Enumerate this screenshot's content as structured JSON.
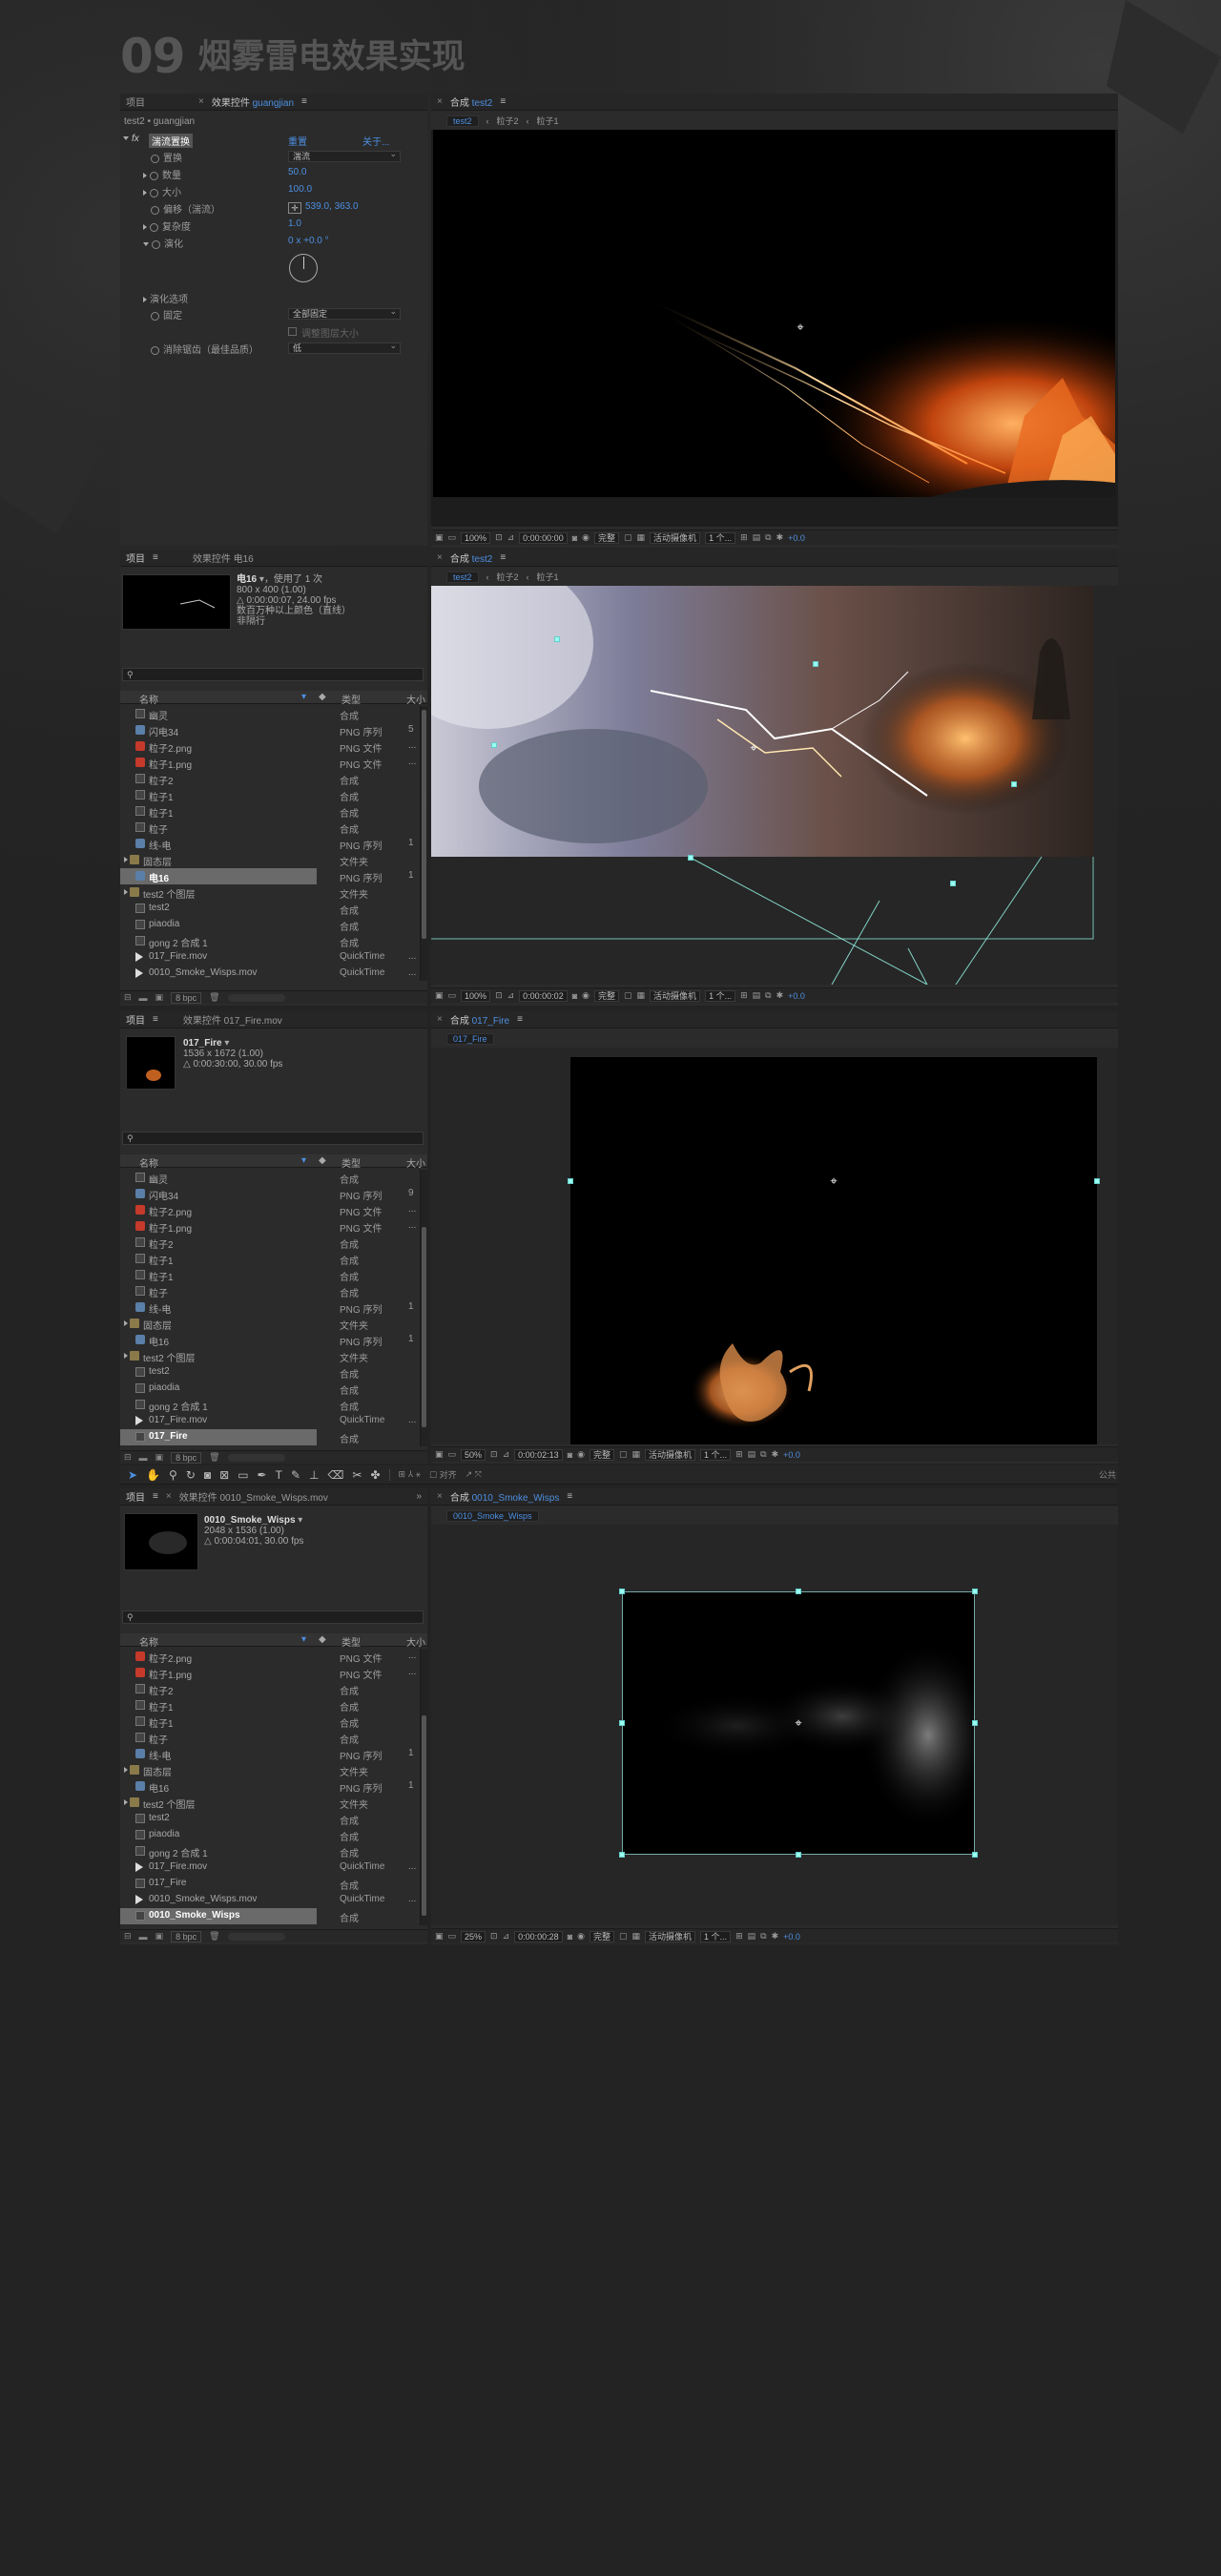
{
  "header": {
    "number": "09",
    "title": "烟雾雷电效果实现"
  },
  "effects_panel": {
    "tab_project": "项目",
    "tab_effects": "效果控件",
    "tab_effects_layer": "guangjian",
    "breadcrumb": "test2 • guangjian",
    "effect_name": "湍流置换",
    "reset": "重置",
    "about": "关于...",
    "props": [
      {
        "label": "置换",
        "value": "湍流"
      },
      {
        "label": "数量",
        "value": "50.0"
      },
      {
        "label": "大小",
        "value": "100.0"
      },
      {
        "label": "偏移（湍流）",
        "value": "539.0, 363.0"
      },
      {
        "label": "复杂度",
        "value": "1.0"
      },
      {
        "label": "演化",
        "value": "0 x +0.0 °"
      }
    ],
    "evolution_options": "演化选项",
    "pin": {
      "label": "固定",
      "value": "全部固定"
    },
    "resize": "调整图层大小",
    "antialias": {
      "label": "消除锯齿（最佳品质）",
      "value": "低"
    }
  },
  "viewer1": {
    "tab_label": "合成",
    "comp_name": "test2",
    "crumbs": [
      "test2",
      "粒子2",
      "粒子1"
    ],
    "toolbar": {
      "zoom": "100%",
      "time": "0:00:00:00",
      "quality": "完整",
      "camera": "活动摄像机",
      "views": "1 个...",
      "exposure": "+0.0"
    }
  },
  "viewer2": {
    "tab_label": "合成",
    "comp_name": "test2",
    "crumbs": [
      "test2",
      "粒子2",
      "粒子1"
    ],
    "toolbar": {
      "zoom": "100%",
      "time": "0:00:00:02",
      "quality": "完整",
      "camera": "活动摄像机",
      "views": "1 个...",
      "exposure": "+0.0"
    }
  },
  "viewer3": {
    "tab_label": "合成",
    "comp_name": "017_Fire",
    "crumbs": [
      "017_Fire"
    ],
    "toolbar": {
      "zoom": "50%",
      "time": "0:00:02:13",
      "quality": "完整",
      "camera": "活动摄像机",
      "views": "1 个...",
      "exposure": "+0.0"
    }
  },
  "viewer4": {
    "tab_label": "合成",
    "comp_name": "0010_Smoke_Wisps",
    "crumbs": [
      "0010_Smoke_Wisps"
    ],
    "toolbar": {
      "zoom": "25%",
      "time": "0:00:00:28",
      "quality": "完整",
      "camera": "活动摄像机",
      "views": "1 个...",
      "exposure": "+0.0"
    }
  },
  "project1": {
    "tab_project": "项目",
    "tab_effects": "效果控件 电16",
    "info_name": "电16",
    "info_used": "，使用了 1 次",
    "info_lines": [
      "800 x 400 (1.00)",
      "△ 0:00:00:07, 24.00 fps",
      "数百万种以上颜色（直线）",
      "非隔行"
    ],
    "col_name": "名称",
    "col_type": "类型",
    "col_size": "大小",
    "bpc": "8 bpc",
    "rows": [
      {
        "name": "幽灵",
        "type": "合成",
        "icon": "comp",
        "extra": ""
      },
      {
        "name": "闪电34",
        "type": "PNG 序列",
        "icon": "img",
        "extra": "5"
      },
      {
        "name": "粒子2.png",
        "type": "PNG 文件",
        "icon": "red",
        "extra": "..."
      },
      {
        "name": "粒子1.png",
        "type": "PNG 文件",
        "icon": "red",
        "extra": "..."
      },
      {
        "name": "粒子2",
        "type": "合成",
        "icon": "comp",
        "extra": ""
      },
      {
        "name": "粒子1",
        "type": "合成",
        "icon": "comp",
        "extra": ""
      },
      {
        "name": "粒子1",
        "type": "合成",
        "icon": "comp",
        "extra": ""
      },
      {
        "name": "粒子",
        "type": "合成",
        "icon": "comp",
        "extra": ""
      },
      {
        "name": "线-电",
        "type": "PNG 序列",
        "icon": "img",
        "extra": "1"
      },
      {
        "name": "固态层",
        "type": "文件夹",
        "icon": "fold",
        "extra": ""
      },
      {
        "name": "电16",
        "type": "PNG 序列",
        "icon": "img",
        "extra": "1",
        "selected": true
      },
      {
        "name": "test2 个图层",
        "type": "文件夹",
        "icon": "fold",
        "extra": ""
      },
      {
        "name": "test2",
        "type": "合成",
        "icon": "comp",
        "extra": ""
      },
      {
        "name": "piaodia",
        "type": "合成",
        "icon": "comp",
        "extra": ""
      },
      {
        "name": "gong 2 合成 1",
        "type": "合成",
        "icon": "comp",
        "extra": ""
      },
      {
        "name": "017_Fire.mov",
        "type": "QuickTime",
        "icon": "mov",
        "extra": "..."
      },
      {
        "name": "0010_Smoke_Wisps.mov",
        "type": "QuickTime",
        "icon": "mov",
        "extra": "..."
      }
    ]
  },
  "project2": {
    "tab_project": "项目",
    "tab_effects": "效果控件 017_Fire.mov",
    "info_name": "017_Fire",
    "info_lines": [
      "1536 x 1672 (1.00)",
      "△ 0:00:30:00, 30.00 fps"
    ],
    "col_name": "名称",
    "col_type": "类型",
    "col_size": "大小",
    "bpc": "8 bpc",
    "rows": [
      {
        "name": "幽灵",
        "type": "合成",
        "icon": "comp",
        "extra": ""
      },
      {
        "name": "闪电34",
        "type": "PNG 序列",
        "icon": "img",
        "extra": "9"
      },
      {
        "name": "粒子2.png",
        "type": "PNG 文件",
        "icon": "red",
        "extra": "..."
      },
      {
        "name": "粒子1.png",
        "type": "PNG 文件",
        "icon": "red",
        "extra": "..."
      },
      {
        "name": "粒子2",
        "type": "合成",
        "icon": "comp",
        "extra": ""
      },
      {
        "name": "粒子1",
        "type": "合成",
        "icon": "comp",
        "extra": ""
      },
      {
        "name": "粒子1",
        "type": "合成",
        "icon": "comp",
        "extra": ""
      },
      {
        "name": "粒子",
        "type": "合成",
        "icon": "comp",
        "extra": ""
      },
      {
        "name": "线-电",
        "type": "PNG 序列",
        "icon": "img",
        "extra": "1"
      },
      {
        "name": "固态层",
        "type": "文件夹",
        "icon": "fold",
        "extra": ""
      },
      {
        "name": "电16",
        "type": "PNG 序列",
        "icon": "img",
        "extra": "1"
      },
      {
        "name": "test2 个图层",
        "type": "文件夹",
        "icon": "fold",
        "extra": ""
      },
      {
        "name": "test2",
        "type": "合成",
        "icon": "comp",
        "extra": ""
      },
      {
        "name": "piaodia",
        "type": "合成",
        "icon": "comp",
        "extra": ""
      },
      {
        "name": "gong 2 合成 1",
        "type": "合成",
        "icon": "comp",
        "extra": ""
      },
      {
        "name": "017_Fire.mov",
        "type": "QuickTime",
        "icon": "mov",
        "extra": "..."
      },
      {
        "name": "017_Fire",
        "type": "合成",
        "icon": "comp",
        "extra": "",
        "selected": true
      }
    ]
  },
  "toolbar_labels": {
    "align": "对齐",
    "public": "公共"
  },
  "project3": {
    "tab_project": "项目",
    "tab_effects": "效果控件 0010_Smoke_Wisps.mov",
    "info_name": "0010_Smoke_Wisps",
    "info_lines": [
      "2048 x 1536 (1.00)",
      "△ 0:00:04:01, 30.00 fps"
    ],
    "col_name": "名称",
    "col_type": "类型",
    "col_size": "大小",
    "bpc": "8 bpc",
    "rows": [
      {
        "name": "粒子2.png",
        "type": "PNG 文件",
        "icon": "red",
        "extra": "..."
      },
      {
        "name": "粒子1.png",
        "type": "PNG 文件",
        "icon": "red",
        "extra": "..."
      },
      {
        "name": "粒子2",
        "type": "合成",
        "icon": "comp",
        "extra": ""
      },
      {
        "name": "粒子1",
        "type": "合成",
        "icon": "comp",
        "extra": ""
      },
      {
        "name": "粒子1",
        "type": "合成",
        "icon": "comp",
        "extra": ""
      },
      {
        "name": "粒子",
        "type": "合成",
        "icon": "comp",
        "extra": ""
      },
      {
        "name": "线-电",
        "type": "PNG 序列",
        "icon": "img",
        "extra": "1"
      },
      {
        "name": "固态层",
        "type": "文件夹",
        "icon": "fold",
        "extra": ""
      },
      {
        "name": "电16",
        "type": "PNG 序列",
        "icon": "img",
        "extra": "1"
      },
      {
        "name": "test2 个图层",
        "type": "文件夹",
        "icon": "fold",
        "extra": ""
      },
      {
        "name": "test2",
        "type": "合成",
        "icon": "comp",
        "extra": ""
      },
      {
        "name": "piaodia",
        "type": "合成",
        "icon": "comp",
        "extra": ""
      },
      {
        "name": "gong 2 合成 1",
        "type": "合成",
        "icon": "comp",
        "extra": ""
      },
      {
        "name": "017_Fire.mov",
        "type": "QuickTime",
        "icon": "mov",
        "extra": "..."
      },
      {
        "name": "017_Fire",
        "type": "合成",
        "icon": "comp",
        "extra": ""
      },
      {
        "name": "0010_Smoke_Wisps.mov",
        "type": "QuickTime",
        "icon": "mov",
        "extra": "..."
      },
      {
        "name": "0010_Smoke_Wisps",
        "type": "合成",
        "icon": "comp",
        "extra": "",
        "selected": true
      }
    ]
  },
  "colors": {
    "accent": "#4d8fe0",
    "panel": "#2b2b2b",
    "background": "#232323",
    "handle": "#99eedd"
  }
}
